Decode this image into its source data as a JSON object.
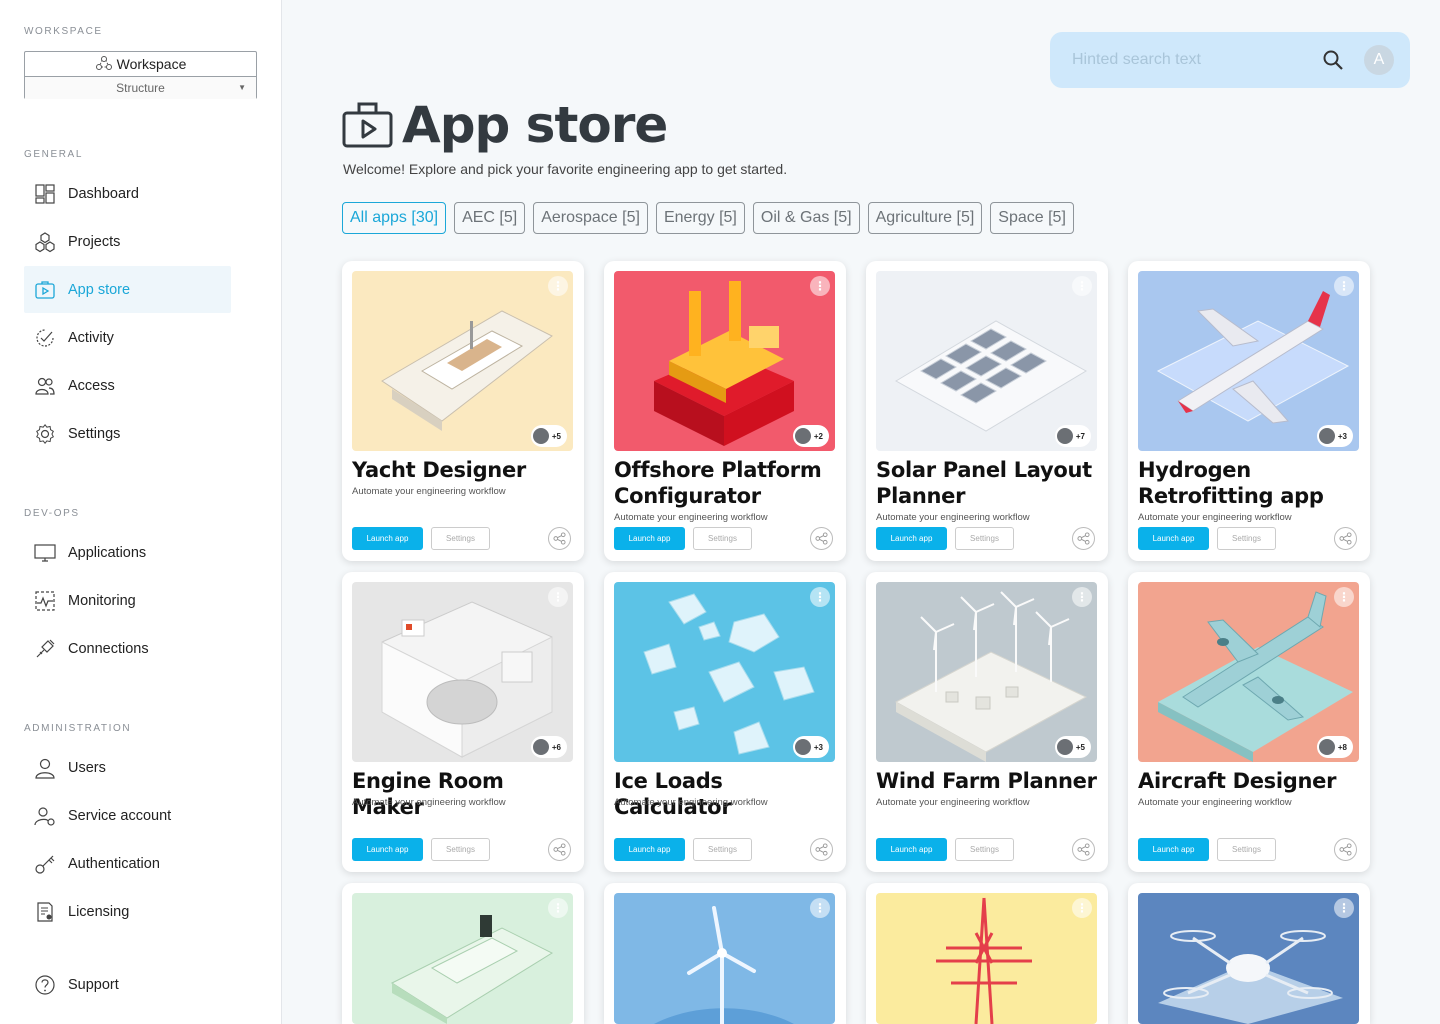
{
  "sidebar": {
    "workspace_section": "WORKSPACE",
    "workspace_name": "Workspace",
    "workspace_sub": "Structure",
    "general_section": "GENERAL",
    "devops_section": "DEV-OPS",
    "admin_section": "ADMINISTRATION",
    "items": {
      "dashboard": "Dashboard",
      "projects": "Projects",
      "app_store": "App store",
      "activity": "Activity",
      "access": "Access",
      "settings": "Settings",
      "applications": "Applications",
      "monitoring": "Monitoring",
      "connections": "Connections",
      "users": "Users",
      "service_account": "Service account",
      "authentication": "Authentication",
      "licensing": "Licensing",
      "support": "Support"
    }
  },
  "search": {
    "placeholder": "Hinted search text",
    "avatar_letter": "A"
  },
  "header": {
    "title": "App store",
    "subtitle": "Welcome! Explore and pick your favorite engineering app to get started."
  },
  "filters": [
    "All apps [30]",
    "AEC [5]",
    "Aerospace  [5]",
    "Energy [5]",
    "Oil & Gas [5]",
    "Agriculture [5]",
    "Space [5]"
  ],
  "cards": [
    {
      "title": "Yacht Designer",
      "desc": "Automate your engineering workflow",
      "users": "+5"
    },
    {
      "title": "Offshore Platform Configurator",
      "desc": "Automate your engineering workflow",
      "users": "+2"
    },
    {
      "title": "Solar Panel Layout Planner",
      "desc": "Automate your engineering workflow",
      "users": "+7"
    },
    {
      "title": "Hydrogen Retrofitting app",
      "desc": "Automate your engineering workflow",
      "users": "+3"
    },
    {
      "title": "Engine Room Maker",
      "desc": "Automate your engineering workflow",
      "users": "+6"
    },
    {
      "title": "Ice Loads Calculator",
      "desc": "Automate your engineering workflow",
      "users": "+3"
    },
    {
      "title": "Wind Farm Planner",
      "desc": "Automate your engineering workflow",
      "users": "+5"
    },
    {
      "title": "Aircraft Designer",
      "desc": "Automate your engineering workflow",
      "users": "+8"
    }
  ],
  "card_buttons": {
    "launch": "Launch app",
    "settings": "Settings"
  },
  "colors": {
    "accent": "#1ba7d8",
    "launch": "#0ab1ea",
    "search_bg": "#cfe8fb"
  }
}
